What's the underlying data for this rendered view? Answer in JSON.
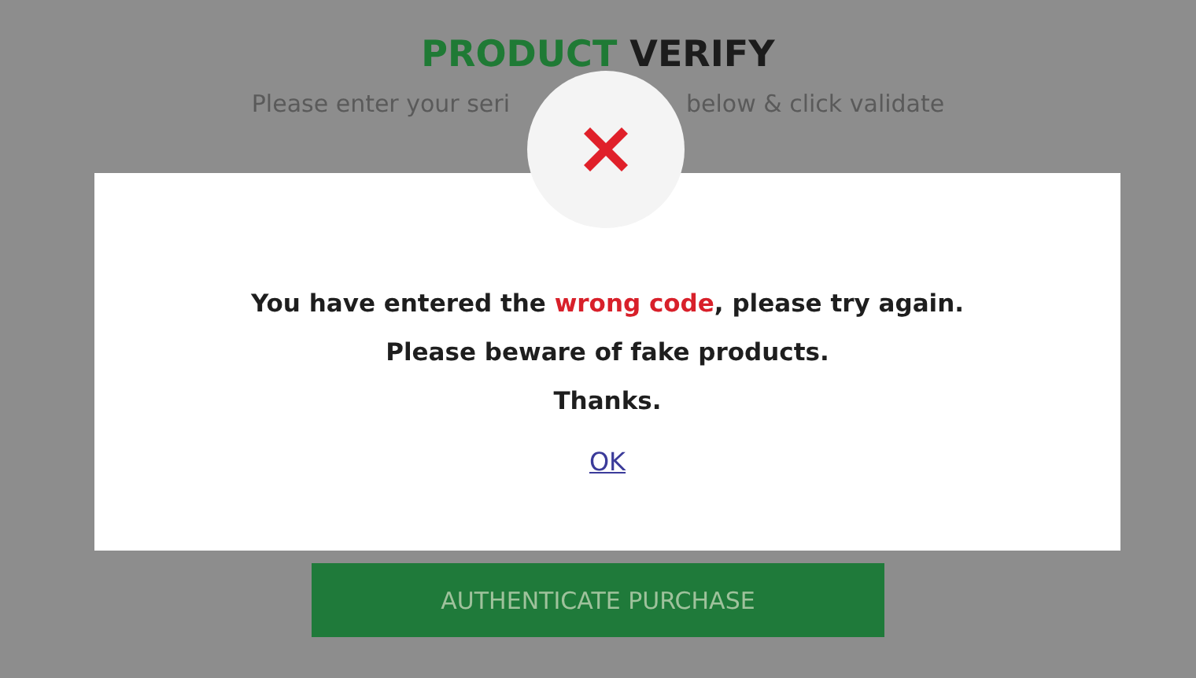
{
  "page": {
    "title": {
      "accent": "PRODUCT",
      "rest": "VERIFY"
    },
    "subtitle_parts": [
      "Please enter your seri",
      "below & click validate"
    ],
    "button": "AUTHENTICATE PURCHASE"
  },
  "dialog": {
    "kind": "error",
    "lines": [
      {
        "before": "You have entered the ",
        "highlight": "wrong code",
        "after": ", please try again."
      },
      {
        "before": "Please beware of fake products."
      },
      {
        "before": "Thanks."
      }
    ],
    "ok": "OK"
  }
}
